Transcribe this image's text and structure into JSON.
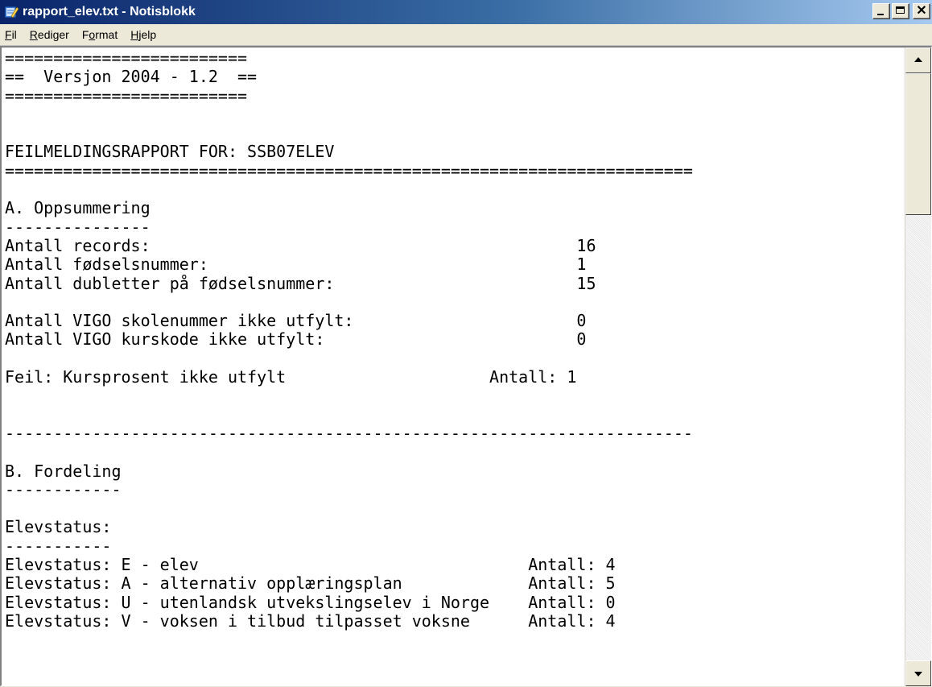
{
  "window": {
    "title": "rapport_elev.txt - Notisblokk",
    "app_icon": "notepad-icon",
    "buttons": {
      "minimize": "minimize-icon",
      "maximize": "maximize-icon",
      "close": "close-icon"
    }
  },
  "menu": {
    "items": [
      {
        "label": "Fil",
        "mnemonic": "F"
      },
      {
        "label": "Rediger",
        "mnemonic": "R"
      },
      {
        "label": "Format",
        "mnemonic": "o"
      },
      {
        "label": "Hjelp",
        "mnemonic": "H"
      }
    ]
  },
  "editor": {
    "lines": [
      "=========================",
      "==  Versjon 2004 - 1.2  ==",
      "=========================",
      "",
      "",
      "FEILMELDINGSRAPPORT FOR: SSB07ELEV",
      "=======================================================================",
      "",
      "A. Oppsummering",
      "---------------",
      "Antall records:                                            16",
      "Antall fødselsnummer:                                      1",
      "Antall dubletter på fødselsnummer:                         15",
      "",
      "Antall VIGO skolenummer ikke utfylt:                       0",
      "Antall VIGO kurskode ikke utfylt:                          0",
      "",
      "Feil: Kursprosent ikke utfylt                     Antall: 1",
      "",
      "",
      "-----------------------------------------------------------------------",
      "",
      "B. Fordeling",
      "------------",
      "",
      "Elevstatus:",
      "-----------",
      "Elevstatus: E - elev                                  Antall: 4",
      "Elevstatus: A - alternativ opplæringsplan             Antall: 5",
      "Elevstatus: U - utenlandsk utvekslingselev i Norge    Antall: 0",
      "Elevstatus: V - voksen i tilbud tilpasset voksne      Antall: 4"
    ]
  },
  "colors": {
    "titlebar_start": "#0a246a",
    "titlebar_end": "#a6caf0",
    "chrome": "#ece9d8"
  }
}
